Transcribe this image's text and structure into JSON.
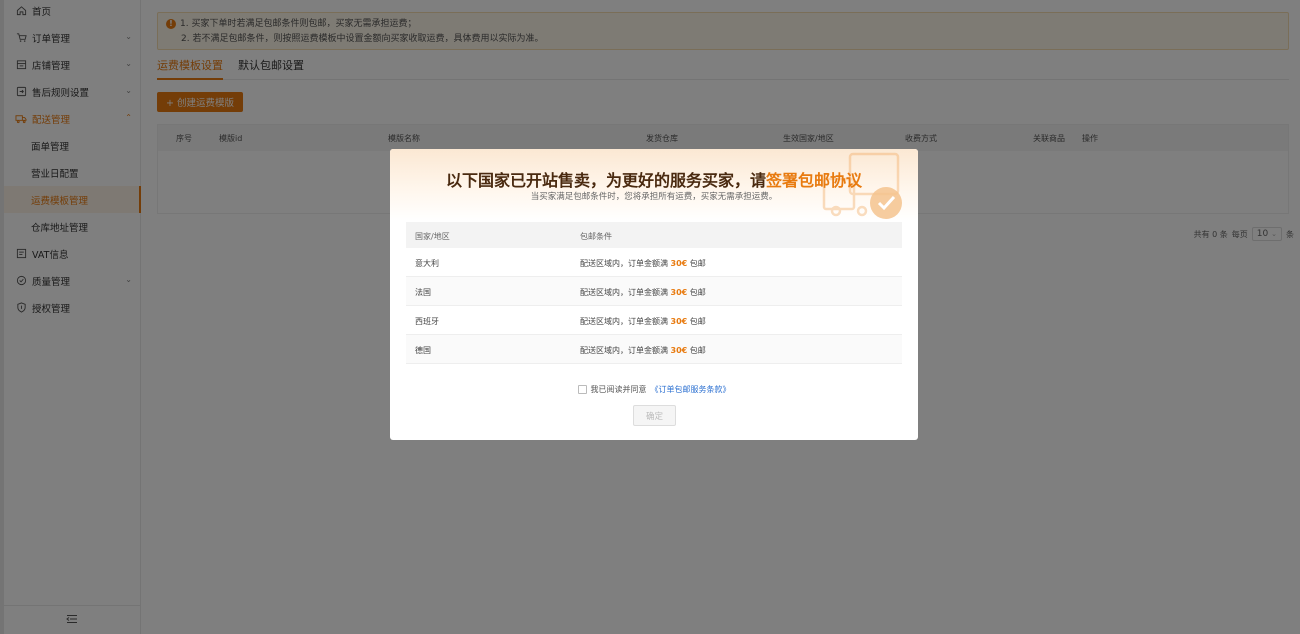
{
  "sidebar": {
    "items": [
      {
        "label": "首页",
        "icon": "home-icon",
        "has_chevron": false
      },
      {
        "label": "订单管理",
        "icon": "cart-icon",
        "has_chevron": true
      },
      {
        "label": "店铺管理",
        "icon": "store-icon",
        "has_chevron": true
      },
      {
        "label": "售后规则设置",
        "icon": "return-icon",
        "has_chevron": true
      },
      {
        "label": "配送管理",
        "icon": "truck-icon",
        "has_chevron": true,
        "expanded": true
      },
      {
        "label": "VAT信息",
        "icon": "vat-icon",
        "has_chevron": false
      },
      {
        "label": "质量管理",
        "icon": "quality-icon",
        "has_chevron": true
      },
      {
        "label": "授权管理",
        "icon": "shield-icon",
        "has_chevron": false
      }
    ],
    "sub_items": [
      "面单管理",
      "营业日配置",
      "运费模板管理",
      "仓库地址管理"
    ],
    "active_sub": "运费模板管理",
    "accent": "#e87b10"
  },
  "notice": {
    "line1": "1. 买家下单时若满足包邮条件则包邮，买家无需承担运费；",
    "line2": "2. 若不满足包邮条件，则按照运费模板中设置金额向买家收取运费，具体费用以实际为准。"
  },
  "tabs": [
    "运费模板设置",
    "默认包邮设置"
  ],
  "create_button": "+ 创建运费模版",
  "table_headers": [
    "序号",
    "模版id",
    "模版名称",
    "发货仓库",
    "生效国家/地区",
    "收费方式",
    "关联商品",
    "操作"
  ],
  "pager": {
    "total": "共有 0 条",
    "per_page_label": "每页",
    "size": "10",
    "unit": "条"
  },
  "modal": {
    "title_prefix": "以下国家已开站售卖，为更好的服务买家，请",
    "title_highlight": "签署包邮协议",
    "subtitle": "当买家满足包邮条件时，您将承担所有运费，买家无需承担运费。",
    "columns": [
      "国家/地区",
      "包邮条件"
    ],
    "rows": [
      {
        "country": "意大利",
        "cond_prefix": "配送区域内，订单金额满",
        "amount": "30€",
        "cond_suffix": "包邮"
      },
      {
        "country": "法国",
        "cond_prefix": "配送区域内，订单金额满",
        "amount": "30€",
        "cond_suffix": "包邮"
      },
      {
        "country": "西班牙",
        "cond_prefix": "配送区域内，订单金额满",
        "amount": "30€",
        "cond_suffix": "包邮"
      },
      {
        "country": "德国",
        "cond_prefix": "配送区域内，订单金额满",
        "amount": "30€",
        "cond_suffix": "包邮"
      }
    ],
    "agree_text": "我已阅读并同意",
    "agree_link": "《订单包邮服务条款》",
    "agree_checked": false,
    "confirm": "确定"
  }
}
